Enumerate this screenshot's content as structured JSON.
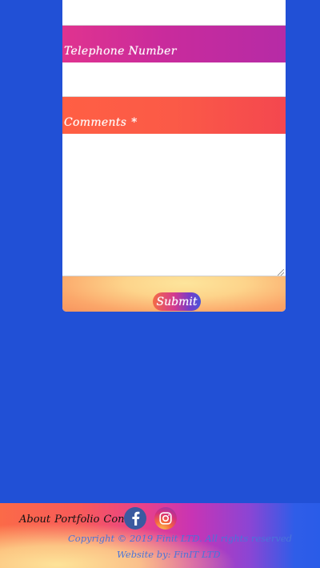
{
  "form": {
    "telephone_label": "Telephone Number",
    "comments_label": "Comments",
    "required_mark": "*",
    "submit_label": "Submit"
  },
  "footer": {
    "nav": {
      "about": "About",
      "portfolio": "Portfolio",
      "contact": "Contact"
    },
    "social": {
      "facebook_icon": "facebook-icon",
      "instagram_icon": "instagram-icon"
    },
    "copyright": "Copyright © 2019 Finit LTD. All rights reserved",
    "credit": "Website by: FinIT LTD"
  },
  "colors": {
    "page_background": "#2150d6",
    "phone_band": "#d1309a",
    "comments_band": "#fb5a47",
    "submit_band": "#fdd48b",
    "footer_text": "#4a74d9"
  }
}
